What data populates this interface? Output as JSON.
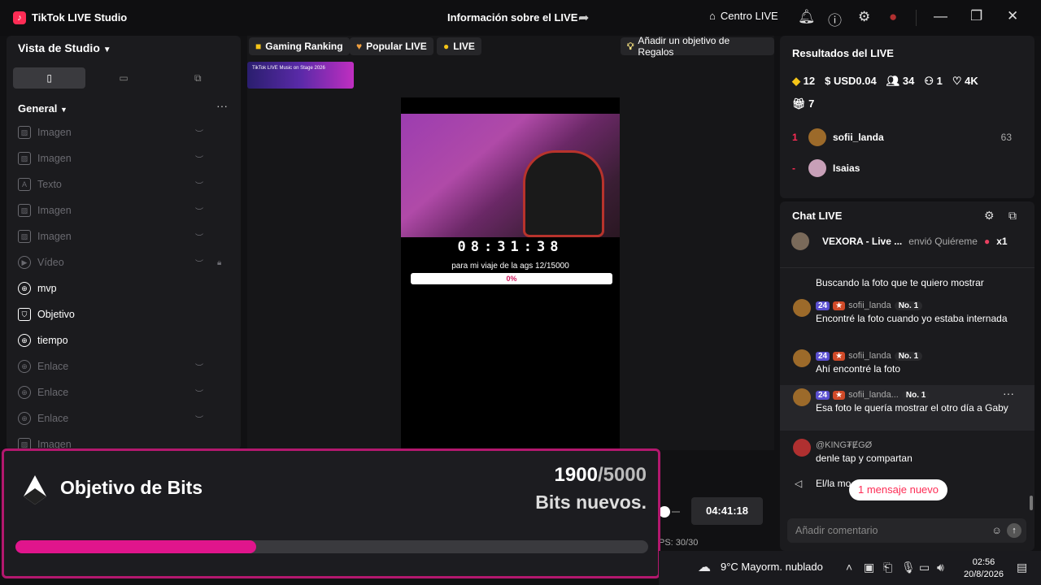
{
  "titlebar": {
    "app_title": "TikTok LIVE Studio",
    "center_title": "Información sobre el LIVE",
    "centro_label": "Centro LIVE"
  },
  "sidebar": {
    "view_title": "Vista de Studio",
    "group_title": "General",
    "sources": [
      {
        "label": "Imagen",
        "icon": "image-icon",
        "enabled": false
      },
      {
        "label": "Imagen",
        "icon": "image-icon",
        "enabled": false
      },
      {
        "label": "Texto",
        "icon": "text-icon",
        "enabled": false
      },
      {
        "label": "Imagen",
        "icon": "image-icon",
        "enabled": false
      },
      {
        "label": "Imagen",
        "icon": "image-icon",
        "enabled": false
      },
      {
        "label": "Vídeo",
        "icon": "video-icon",
        "enabled": false
      },
      {
        "label": "mvp",
        "icon": "globe-icon",
        "enabled": true
      },
      {
        "label": "Objetivo",
        "icon": "shield-icon",
        "enabled": true
      },
      {
        "label": "tiempo",
        "icon": "globe-icon",
        "enabled": true
      },
      {
        "label": "Enlace",
        "icon": "globe-icon",
        "enabled": false
      },
      {
        "label": "Enlace",
        "icon": "globe-icon",
        "enabled": false
      },
      {
        "label": "Enlace",
        "icon": "globe-icon",
        "enabled": false
      },
      {
        "label": "Imagen",
        "icon": "image-icon",
        "enabled": false
      }
    ]
  },
  "preview": {
    "pills": [
      "Gaming Ranking",
      "Popular LIVE",
      "LIVE"
    ],
    "gift_goal_label": "Añadir un objetivo de Regalos",
    "banner_text": "TikTok LIVE Music on Stage 2026",
    "timer": "08:31:38",
    "goal_text": "para mi viaje de la ags 12/15000",
    "goal_percent": "0%",
    "stream_time": "04:41:18",
    "fps_text": "PS: 30/30"
  },
  "results": {
    "title": "Resultados del LIVE",
    "diamonds": "12",
    "usd": "USD0.04",
    "viewers": "34",
    "new_followers": "1",
    "likes": "4K",
    "gifts": "7",
    "ranking": [
      {
        "rank": "1",
        "name": "sofii_landa",
        "score": "63"
      },
      {
        "rank": "-",
        "name": "Isaias",
        "score": ""
      }
    ]
  },
  "chat": {
    "title": "Chat LIVE",
    "gift": {
      "user": "VEXORA - Live ...",
      "action": "envió Quiéreme",
      "count": "x1"
    },
    "messages": [
      {
        "user": "",
        "level": "",
        "text": "Buscando la foto que te quiero mostrar"
      },
      {
        "user": "sofii_landa",
        "level": "24",
        "rank": "No. 1",
        "text": "Encontré la foto cuando yo estaba internada"
      },
      {
        "user": "sofii_landa",
        "level": "24",
        "rank": "No. 1",
        "text": "Ahí encontré la foto"
      },
      {
        "user": "sofii_landa...",
        "level": "24",
        "rank": "No. 1",
        "text": "Esa foto le quería mostrar el otro día a Gaby"
      },
      {
        "user": "@KING₮ɆGØ",
        "level": "",
        "text": "denle tap y compartan"
      },
      {
        "user": "",
        "level": "",
        "text": "El/la mo"
      }
    ],
    "new_message_label": "1 mensaje nuevo",
    "comment_placeholder": "Añadir comentario"
  },
  "overlay": {
    "title": "Objetivo de Bits",
    "current": "1900",
    "total": "/5000",
    "subtitle": "Bits nuevos.",
    "progress": 0.38
  },
  "taskbar": {
    "weather": "9°C  Mayorm. nublado",
    "time": "02:56",
    "date": "20/8/2026"
  }
}
